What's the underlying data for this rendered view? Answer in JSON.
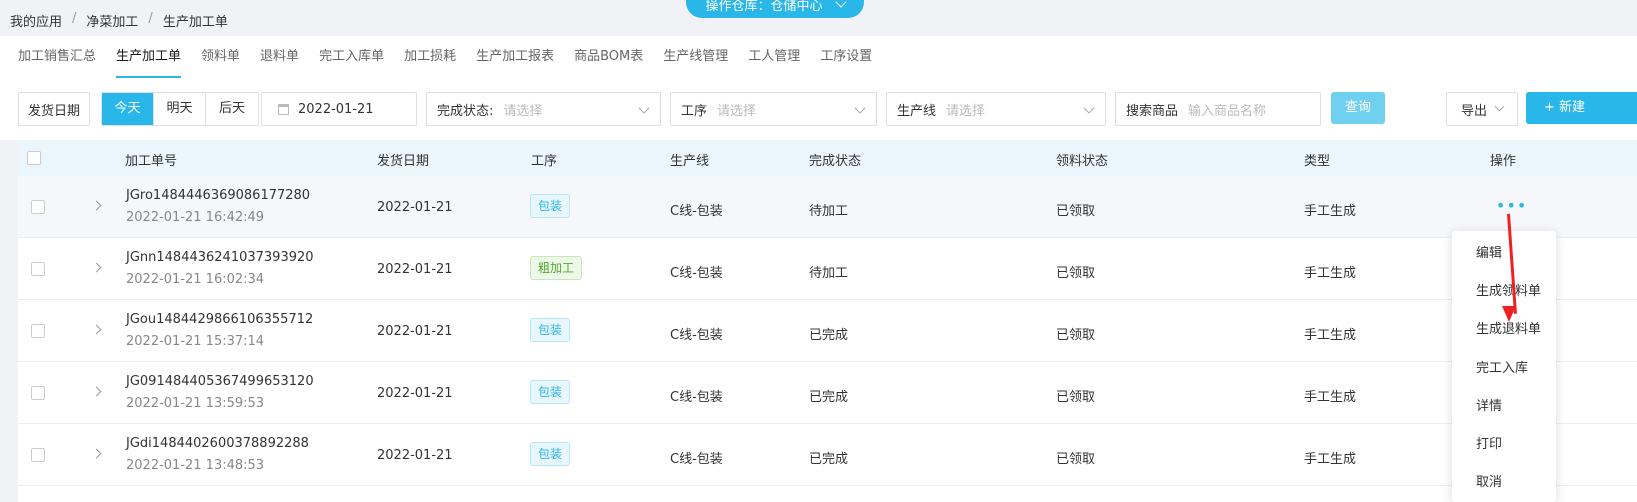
{
  "breadcrumb": [
    "我的应用",
    "净菜加工",
    "生产加工单"
  ],
  "warehouse": "操作仓库：仓储中心",
  "tabs": [
    "加工销售汇总",
    "生产加工单",
    "领料单",
    "退料单",
    "完工入库单",
    "加工损耗",
    "生产加工报表",
    "商品BOM表",
    "生产线管理",
    "工人管理",
    "工序设置"
  ],
  "filters": {
    "date_label": "发货日期",
    "quick": [
      "今天",
      "明天",
      "后天"
    ],
    "date_value": "2022-01-21",
    "status_label": "完成状态:",
    "status_placeholder": "请选择",
    "process_label": "工序",
    "process_placeholder": "请选择",
    "line_label": "生产线",
    "line_placeholder": "请选择",
    "search_label": "搜索商品",
    "search_placeholder": "输入商品名称",
    "query_label": "查询",
    "export_label": "导出",
    "new_label": "+ 新建"
  },
  "columns": [
    "加工单号",
    "发货日期",
    "工序",
    "生产线",
    "完成状态",
    "领料状态",
    "类型",
    "操作"
  ],
  "rows": [
    {
      "id": "JGro1484446369086177280",
      "time": "2022-01-21 16:42:49",
      "date": "2022-01-21",
      "process": "包装",
      "line": "C线-包装",
      "status": "待加工",
      "pick": "已领取",
      "type": "手工生成"
    },
    {
      "id": "JGnn1484436241037393920",
      "time": "2022-01-21 16:02:34",
      "date": "2022-01-21",
      "process": "粗加工",
      "line": "C线-包装",
      "status": "待加工",
      "pick": "已领取",
      "type": "手工生成"
    },
    {
      "id": "JGou1484429866106355712",
      "time": "2022-01-21 15:37:14",
      "date": "2022-01-21",
      "process": "包装",
      "line": "C线-包装",
      "status": "已完成",
      "pick": "已领取",
      "type": "手工生成"
    },
    {
      "id": "JG091484405367499653120",
      "time": "2022-01-21 13:59:53",
      "date": "2022-01-21",
      "process": "包装",
      "line": "C线-包装",
      "status": "已完成",
      "pick": "已领取",
      "type": "手工生成"
    },
    {
      "id": "JGdi1484402600378892288",
      "time": "2022-01-21 13:48:53",
      "date": "2022-01-21",
      "process": "包装",
      "line": "C线-包装",
      "status": "已完成",
      "pick": "已领取",
      "type": "手工生成"
    }
  ],
  "ops_icon": "more-dots-icon",
  "menu": [
    "编辑",
    "生成领料单",
    "生成退料单",
    "完工入库",
    "详情",
    "打印",
    "取消"
  ]
}
